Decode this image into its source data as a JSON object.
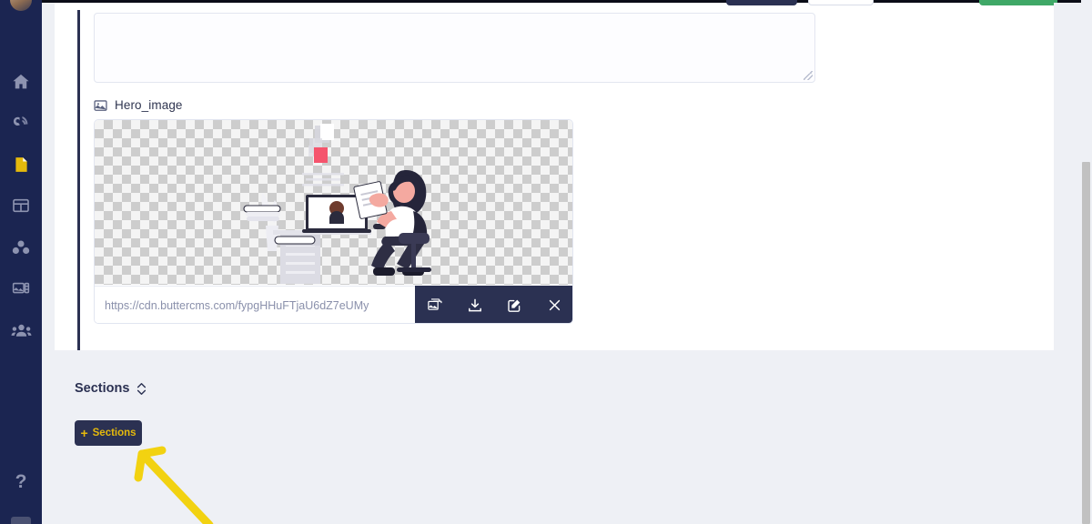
{
  "sidebar": {
    "avatar": "user-avatar",
    "items": [
      {
        "icon": "home-icon",
        "name": "home",
        "active": false
      },
      {
        "icon": "blog-icon",
        "name": "blog",
        "active": false
      },
      {
        "icon": "pages-icon",
        "name": "pages",
        "active": true
      },
      {
        "icon": "collections-icon",
        "name": "collections",
        "active": false
      },
      {
        "icon": "components-icon",
        "name": "components",
        "active": false
      },
      {
        "icon": "media-icon",
        "name": "media",
        "active": false
      },
      {
        "icon": "users-icon",
        "name": "users",
        "active": false
      }
    ],
    "help_label": "?",
    "help_icon": "question-mark-icon"
  },
  "toolbar": {
    "primary_label": "",
    "secondary_label": "",
    "publish_label": ""
  },
  "editor": {
    "textarea_value": "",
    "textarea_placeholder": ""
  },
  "field": {
    "label": "Hero_image",
    "icon": "image-icon",
    "image_url": "https://cdn.buttercms.com/fypgHHuFTjaU6dZ7eUMy",
    "actions": [
      {
        "name": "replace-image",
        "icon": "images-stack-icon"
      },
      {
        "name": "download-image",
        "icon": "download-icon"
      },
      {
        "name": "edit-image",
        "icon": "pencil-square-icon"
      },
      {
        "name": "remove-image",
        "icon": "close-icon"
      }
    ]
  },
  "sections": {
    "heading": "Sections",
    "sort_icon": "chevron-up-down-icon",
    "add_button_label": "Sections",
    "add_button_plus": "+"
  },
  "annotation": {
    "type": "arrow",
    "color": "#f2d211",
    "points_to": "add-sections-button"
  },
  "colors": {
    "sidebar_bg": "#1b2551",
    "accent_yellow": "#e5b90c",
    "button_dark": "#2b3152",
    "page_bg": "#eef0f5",
    "publish_green": "#3fa867",
    "annotation_yellow": "#f2d211"
  },
  "scrollbar": {
    "name": "vertical-scrollbar"
  }
}
